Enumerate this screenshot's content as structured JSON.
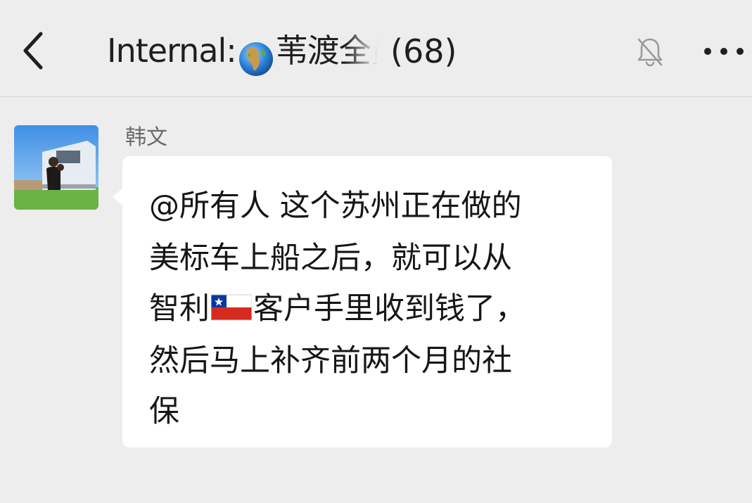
{
  "header": {
    "back_icon": "chevron-left-icon",
    "title_prefix": "Internal:",
    "title_emoji": "globe-icon",
    "title_name": "苇渡全员Windro",
    "member_count": "(68)",
    "mute_icon": "bell-muted-icon",
    "more_icon": "more-horizontal-icon"
  },
  "message": {
    "sender_name": "韩文",
    "lines": [
      "@所有人 这个苏州正在做的",
      "美标车上船之后，就可以从",
      "智利",
      "客户手里收到钱了，",
      "然后马上补齐前两个月的社",
      "保"
    ],
    "flag_icon": "chile-flag-icon"
  },
  "colors": {
    "background": "#ededed",
    "bubble": "#ffffff",
    "text": "#161616",
    "sender": "#6b6b6b"
  }
}
